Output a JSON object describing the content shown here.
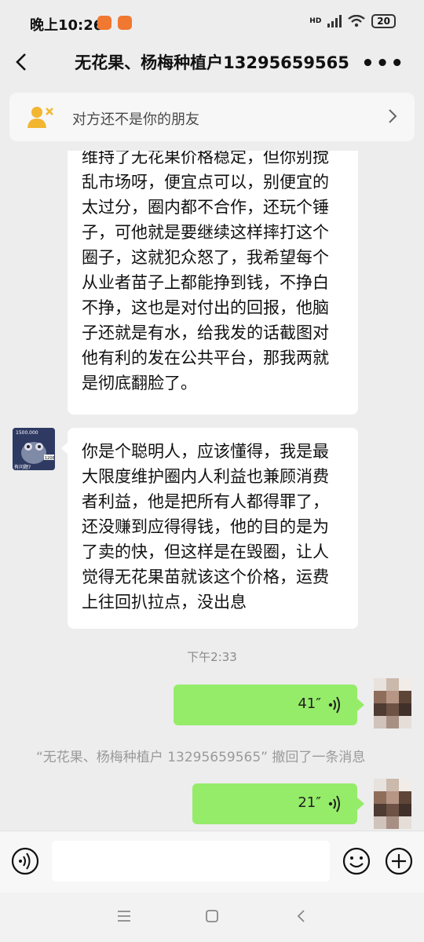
{
  "status_bar": {
    "time": "晚上10:26",
    "network": "HD",
    "battery": "20"
  },
  "header": {
    "title": "无花果、杨梅种植户13295659565"
  },
  "notice": {
    "text": "对方还不是你的朋友"
  },
  "messages": [
    {
      "side": "left",
      "lines": [
        "维持了无花果价格稳定，但你别搅",
        "乱市场呀，便宜点可以，别便宜的",
        "太过分，圈内都不合作，还玩个锤",
        "子，可他就是要继续这样摔打这个",
        "圈子，这就犯众怒了，我希望每个",
        "从业者苗子上都能挣到钱，不挣白",
        "不挣，这也是对付出的回报，他脑",
        "子还就是有水，给我发的话截图对",
        "他有利的发在公共平台，那我两就",
        "是彻底翻脸了。"
      ]
    },
    {
      "side": "left",
      "lines": [
        "你是个聪明人，应该懂得，我是最",
        "大限度维护圈内人利益也兼顾消费",
        "者利益，他是把所有人都得罪了，",
        "还没赚到应得得钱，他的目的是为",
        "了卖的快，但这样是在毁圈，让人",
        "觉得无花果苗就该这个价格，运费",
        "上往回扒拉点，没出息"
      ]
    }
  ],
  "avatar_left_text": [
    "1500.000",
    "1208",
    "有问题?"
  ],
  "timestamp": "下午2:33",
  "voice_messages": [
    {
      "duration": "41″"
    },
    {
      "duration": "21″"
    }
  ],
  "recall_notice": "“无花果、杨梅种植户 13295659565” 撤回了一条消息",
  "colors": {
    "background": "#ededed",
    "bubble_self": "#95ec69",
    "bubble_other": "#ffffff"
  }
}
